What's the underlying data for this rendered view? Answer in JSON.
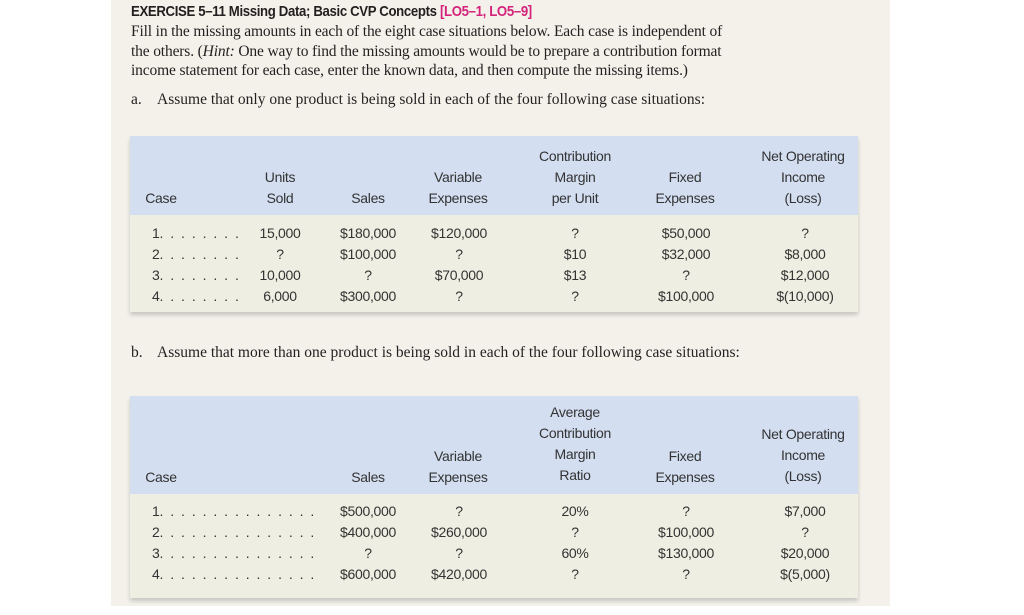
{
  "exercise": {
    "title": "EXERCISE 5–11 Missing Data; Basic CVP Concepts",
    "learning_objectives": "[LO5–1, LO5–9]",
    "accent_color": "#d4237b",
    "instructions": [
      "Fill in the missing amounts in each of the eight case situations below. Each case is independent of",
      "the others. (",
      "Hint:",
      " One way to find the missing amounts would be to prepare a contribution format",
      "income statement for each case, enter the known data, and then compute the missing items.)"
    ]
  },
  "part_a": {
    "label": "a.",
    "text": "Assume that only one product is being sold in each of the four following case situations:",
    "headers": {
      "case": "Case",
      "units_sold": [
        "Units",
        "Sold"
      ],
      "sales": "Sales",
      "variable_expenses": [
        "Variable",
        "Expenses"
      ],
      "cm_per_unit": [
        "Contribution",
        "Margin",
        "per Unit"
      ],
      "fixed_expenses": [
        "Fixed",
        "Expenses"
      ],
      "noi": [
        "Net Operating",
        "Income",
        "(Loss)"
      ]
    },
    "rows": [
      {
        "case": "1",
        "dots": ". . . . . . . .",
        "units_sold": "15,000",
        "sales": "$180,000",
        "variable_expenses": "$120,000",
        "cm_per_unit": "?",
        "fixed_expenses": "$50,000",
        "noi": "?"
      },
      {
        "case": "2",
        "dots": ". . . . . . . .",
        "units_sold": "?",
        "sales": "$100,000",
        "variable_expenses": "?",
        "cm_per_unit": "$10",
        "fixed_expenses": "$32,000",
        "noi": "$8,000"
      },
      {
        "case": "3",
        "dots": ". . . . . . . .",
        "units_sold": "10,000",
        "sales": "?",
        "variable_expenses": "$70,000",
        "cm_per_unit": "$13",
        "fixed_expenses": "?",
        "noi": "$12,000"
      },
      {
        "case": "4",
        "dots": ". . . . . . . .",
        "units_sold": "6,000",
        "sales": "$300,000",
        "variable_expenses": "?",
        "cm_per_unit": "?",
        "fixed_expenses": "$100,000",
        "noi": "$(10,000)"
      }
    ]
  },
  "part_b": {
    "label": "b.",
    "text": "Assume that more than one product is being sold in each of the four following case situations:",
    "headers": {
      "case": "Case",
      "sales": "Sales",
      "variable_expenses": [
        "Variable",
        "Expenses"
      ],
      "avg_cm_ratio": [
        "Average",
        "Contribution",
        "Margin",
        "Ratio"
      ],
      "fixed_expenses": [
        "Fixed",
        "Expenses"
      ],
      "noi": [
        "Net Operating",
        "Income",
        "(Loss)"
      ]
    },
    "rows": [
      {
        "case": "1",
        "dots": ". . . . . . . . . . . . . . .",
        "sales": "$500,000",
        "variable_expenses": "?",
        "avg_cm_ratio": "20%",
        "fixed_expenses": "?",
        "noi": "$7,000"
      },
      {
        "case": "2",
        "dots": ". . . . . . . . . . . . . . .",
        "sales": "$400,000",
        "variable_expenses": "$260,000",
        "avg_cm_ratio": "?",
        "fixed_expenses": "$100,000",
        "noi": "?"
      },
      {
        "case": "3",
        "dots": ". . . . . . . . . . . . . . .",
        "sales": "?",
        "variable_expenses": "?",
        "avg_cm_ratio": "60%",
        "fixed_expenses": "$130,000",
        "noi": "$20,000"
      },
      {
        "case": "4",
        "dots": ". . . . . . . . . . . . . . .",
        "sales": "$600,000",
        "variable_expenses": "$420,000",
        "avg_cm_ratio": "?",
        "fixed_expenses": "?",
        "noi": "$(5,000)"
      }
    ]
  }
}
